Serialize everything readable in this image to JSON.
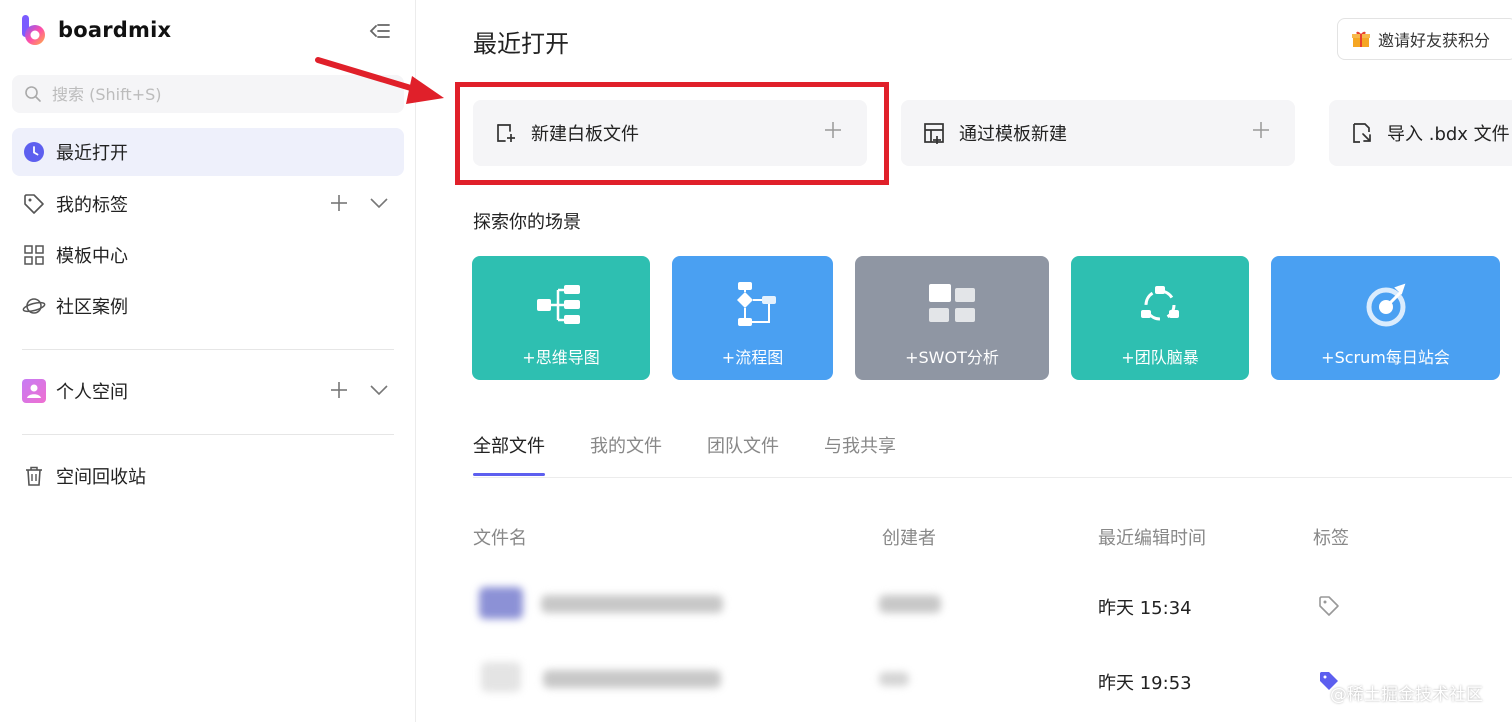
{
  "brand": {
    "name": "boardmix"
  },
  "search": {
    "placeholder": "搜索 (Shift+S)"
  },
  "sidebar": {
    "items": [
      {
        "label": "最近打开"
      },
      {
        "label": "我的标签"
      },
      {
        "label": "模板中心"
      },
      {
        "label": "社区案例"
      },
      {
        "label": "个人空间"
      },
      {
        "label": "空间回收站"
      }
    ]
  },
  "header": {
    "title": "最近打开",
    "invite_label": "邀请好友获积分"
  },
  "create": {
    "new_board": "新建白板文件",
    "from_template": "通过模板新建",
    "import_bdx": "导入 .bdx 文件"
  },
  "explore": {
    "title": "探索你的场景",
    "scenes": [
      {
        "label": "+思维导图",
        "color": "#2ebfb1"
      },
      {
        "label": "+流程图",
        "color": "#4aa0f2"
      },
      {
        "label": "+SWOT分析",
        "color": "#8f96a3"
      },
      {
        "label": "+团队脑暴",
        "color": "#2ebfb1"
      },
      {
        "label": "+Scrum每日站会",
        "color": "#4aa0f2"
      }
    ]
  },
  "tabs": [
    "全部文件",
    "我的文件",
    "团队文件",
    "与我共享"
  ],
  "table": {
    "headers": {
      "name": "文件名",
      "creator": "创建者",
      "edited": "最近编辑时间",
      "tags": "标签"
    },
    "rows": [
      {
        "edited": "昨天 15:34"
      },
      {
        "edited": "昨天 19:53"
      }
    ]
  },
  "watermark": "@稀土掘金技术社区",
  "colors": {
    "accent": "#5d5fef",
    "highlight": "#e0202a",
    "active_bg": "#eef0fb"
  }
}
